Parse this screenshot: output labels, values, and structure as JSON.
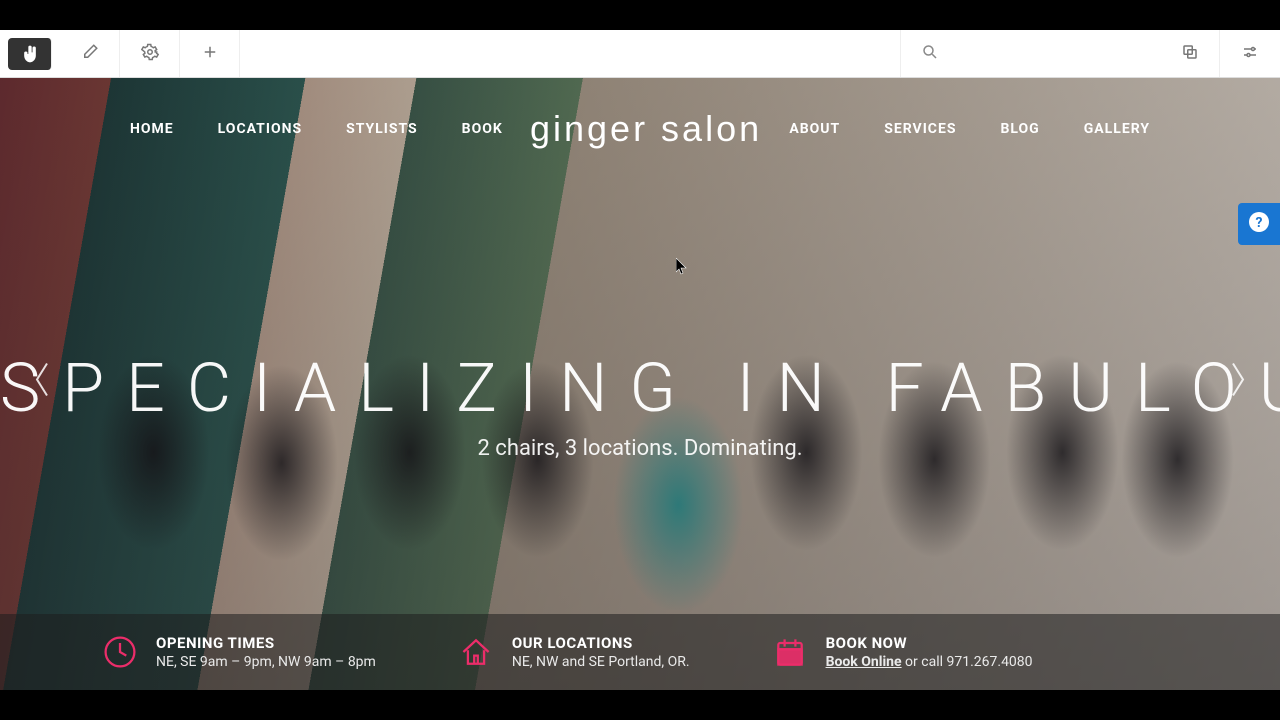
{
  "editor": {
    "tools": [
      "hand",
      "edit",
      "settings",
      "add"
    ],
    "right_tools": [
      "copy",
      "sliders"
    ]
  },
  "nav": {
    "left": [
      "HOME",
      "LOCATIONS",
      "STYLISTS",
      "BOOK"
    ],
    "right": [
      "ABOUT",
      "SERVICES",
      "BLOG",
      "GALLERY"
    ]
  },
  "logo": "ginger salon",
  "hero": {
    "title": "SPECIALIZING IN FABULOUS",
    "subtitle": "2 chairs, 3 locations. Dominating."
  },
  "info": {
    "opening": {
      "title": "OPENING TIMES",
      "detail": "NE, SE 9am – 9pm, NW 9am – 8pm"
    },
    "locations": {
      "title": "OUR LOCATIONS",
      "detail": "NE, NW and SE Portland, OR."
    },
    "book": {
      "title": "BOOK NOW",
      "link": "Book Online",
      "rest": " or call 971.267.4080"
    }
  },
  "colors": {
    "accent": "#ec2d6a",
    "help": "#1976d2"
  }
}
